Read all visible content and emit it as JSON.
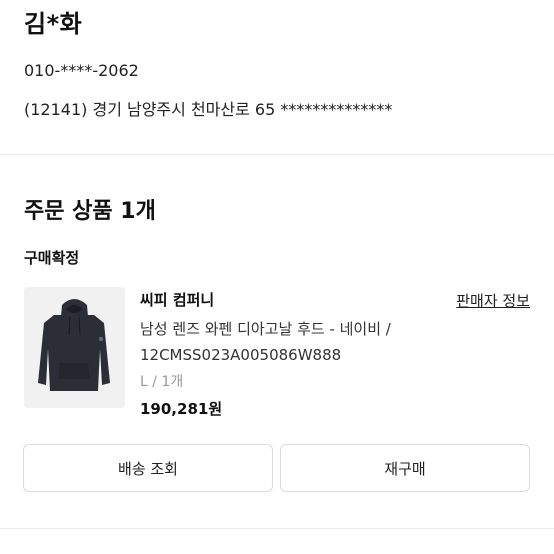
{
  "recipient": {
    "name": "김*화",
    "phone": "010-****-2062",
    "address": "(12141) 경기 남양주시 천마산로 65 **************"
  },
  "order": {
    "title": "주문 상품 1개",
    "status": "구매확정",
    "item": {
      "brand": "씨피 컴퍼니",
      "seller_link": "판매자 정보",
      "name": "남성 렌즈 와펜 디아고날 후드 - 네이비 / 12CMSS023A005086W888",
      "option": "L / 1개",
      "price": "190,281원",
      "image_icon": "navy-hoodie-image"
    },
    "buttons": {
      "track": "배송 조회",
      "reorder": "재구매"
    }
  },
  "colors": {
    "text": "#111111",
    "muted": "#999999",
    "border": "#dcdcdc",
    "hoodie": "#2b2e36"
  }
}
